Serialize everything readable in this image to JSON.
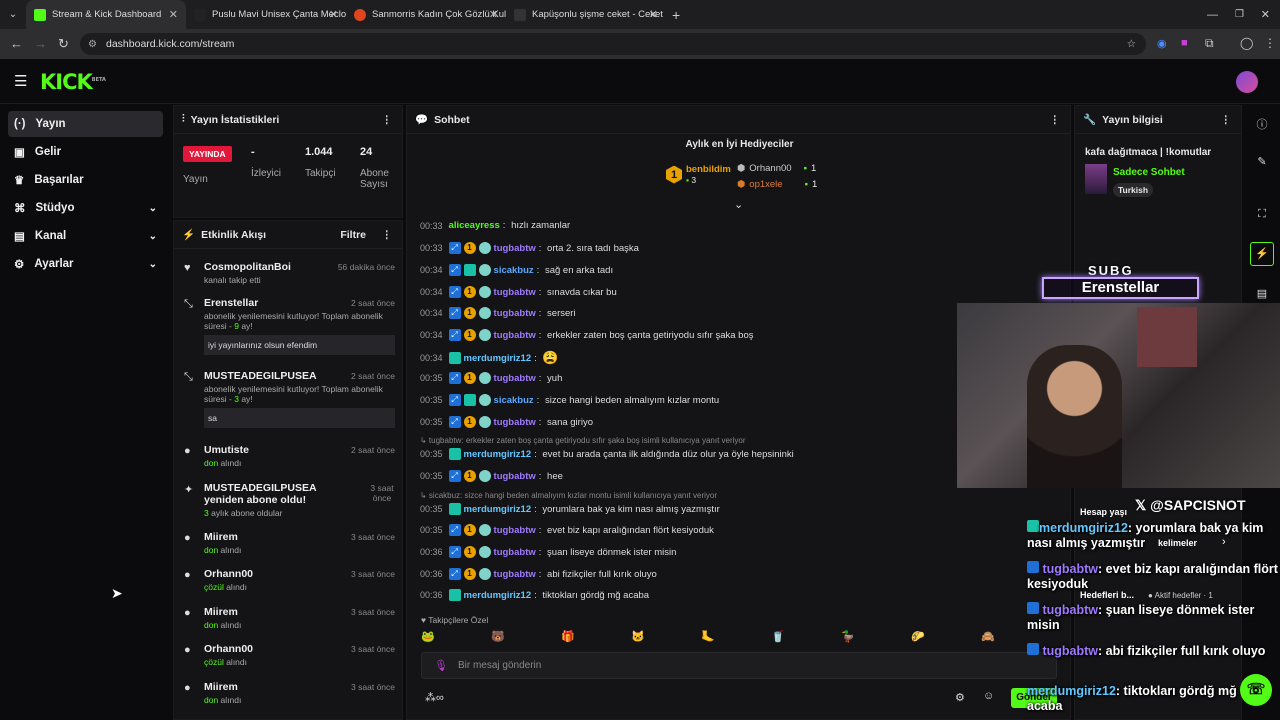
{
  "browser": {
    "tabs": [
      {
        "title": "Stream & Kick Dashboard",
        "active": true
      },
      {
        "title": "Puslu Mavi Unisex Çanta Meclo"
      },
      {
        "title": "Sanmorris Kadın Çok Gözlü Kul"
      },
      {
        "title": "Kapüşonlu şişme ceket - Ceket"
      }
    ],
    "url": "dashboard.kick.com/stream"
  },
  "app": {
    "logo": "KICK",
    "logo_sup": "BETA"
  },
  "sidebar": {
    "items": [
      {
        "label": "Yayın",
        "icon": "broadcast-icon",
        "active": true
      },
      {
        "label": "Gelir",
        "icon": "wallet-icon"
      },
      {
        "label": "Başarılar",
        "icon": "trophy-icon"
      },
      {
        "label": "Stüdyo",
        "icon": "studio-icon",
        "expandable": true
      },
      {
        "label": "Kanal",
        "icon": "channel-icon",
        "expandable": true
      },
      {
        "label": "Ayarlar",
        "icon": "gear-icon",
        "expandable": true
      }
    ]
  },
  "stats": {
    "title": "Yayın İstatistikleri",
    "live_badge": "YAYINDA",
    "live_label": "Yayın",
    "viewers_value": "-",
    "viewers_label": "İzleyici",
    "followers_value": "1.044",
    "followers_label": "Takipçi",
    "subs_value": "24",
    "subs_label": "Abone Sayısı"
  },
  "activity": {
    "title": "Etkinlik Akışı",
    "filter_label": "Filtre",
    "events": [
      {
        "name": "CosmopolitanBoi",
        "time": "56 dakika önce",
        "sub": "kanalı takip etti"
      },
      {
        "name": "Erenstellar",
        "time": "2 saat önce",
        "sub_pre": "abonelik yenilemesini kutluyor! Toplam abonelik süresi - ",
        "sub_hl": "9",
        "sub_post": " ay!",
        "msg": "iyi yayınlarınız olsun efendim"
      },
      {
        "name": "MUSTEADEGILPUSEA",
        "time": "2 saat önce",
        "sub_pre": "abonelik yenilemesini kutluyor! Toplam abonelik süresi - ",
        "sub_hl": "3",
        "sub_post": " ay!",
        "msg": "sa"
      },
      {
        "name": "Umutiste",
        "time": "2 saat önce",
        "sub_hl": "don",
        "sub_post": " alındı"
      },
      {
        "name": "MUSTEADEGILPUSEA yeniden abone oldu!",
        "time": "3 saat önce",
        "sub_hl": "3",
        "sub_post": " aylık abone oldular"
      },
      {
        "name": "Miirem",
        "time": "3 saat önce",
        "sub_hl": "don",
        "sub_post": " alındı"
      },
      {
        "name": "Orhann00",
        "time": "3 saat önce",
        "sub_hl": "çözül",
        "sub_post": " alındı"
      },
      {
        "name": "Miirem",
        "time": "3 saat önce",
        "sub_hl": "don",
        "sub_post": " alındı"
      },
      {
        "name": "Orhann00",
        "time": "3 saat önce",
        "sub_hl": "çözül",
        "sub_post": " alındı"
      },
      {
        "name": "Miirem",
        "time": "3 saat önce",
        "sub_hl": "don",
        "sub_post": " alındı"
      }
    ]
  },
  "chat": {
    "title": "Sohbet",
    "gifters_title": "Aylık en İyi Hediyeciler",
    "gifters": [
      {
        "rank": "1",
        "name": "benbildim",
        "count": "3"
      },
      {
        "name": "Orhann00",
        "count": "1"
      },
      {
        "name": "op1xele",
        "count": "1"
      }
    ],
    "messages": [
      {
        "time": "00:33",
        "user": "aliceayress",
        "cls": "u-ali",
        "text": "hızlı zamanlar",
        "badges": false
      },
      {
        "time": "00:33",
        "user": "tugbabtw",
        "cls": "u-tug",
        "text": "orta 2. sıra tadı başka"
      },
      {
        "time": "00:34",
        "user": "sicakbuz",
        "cls": "u-sic",
        "text": "sağ en arka tadı"
      },
      {
        "time": "00:34",
        "user": "tugbabtw",
        "cls": "u-tug",
        "text": "sınavda cıkar bu"
      },
      {
        "time": "00:34",
        "user": "tugbabtw",
        "cls": "u-tug",
        "text": "serseri"
      },
      {
        "time": "00:34",
        "user": "tugbabtw",
        "cls": "u-tug",
        "text": "erkekler zaten boş çanta getiriyodu sıfır şaka boş"
      },
      {
        "time": "00:34",
        "user": "merdumgiriz12",
        "cls": "u-mer",
        "text": "😩",
        "mer": true
      },
      {
        "time": "00:35",
        "user": "tugbabtw",
        "cls": "u-tug",
        "text": "yuh"
      },
      {
        "time": "00:35",
        "user": "sicakbuz",
        "cls": "u-sic",
        "text": "sizce hangi beden almalıyım kızlar montu"
      },
      {
        "time": "00:35",
        "user": "tugbabtw",
        "cls": "u-tug",
        "text": "sana giriyo"
      },
      {
        "reply": "↳ tugbabtw: erkekler zaten boş çanta getiriyodu sıfır şaka boş isimli kullanıcıya yanıt veriyor"
      },
      {
        "time": "00:35",
        "user": "merdumgiriz12",
        "cls": "u-mer",
        "text": "evet bu arada çanta ilk aldığında düz olur ya öyle hepsininki",
        "mer": true
      },
      {
        "time": "00:35",
        "user": "tugbabtw",
        "cls": "u-tug",
        "text": "hee"
      },
      {
        "reply": "↳ sicakbuz: sizce hangi beden almalıyım kızlar montu isimli kullanıcıya yanıt veriyor"
      },
      {
        "time": "00:35",
        "user": "merdumgiriz12",
        "cls": "u-mer",
        "text": "yorumlara bak ya kim nası almış yazmıştır",
        "mer": true
      },
      {
        "time": "00:35",
        "user": "tugbabtw",
        "cls": "u-tug",
        "text": "evet biz kapı aralığından flört kesiyoduk"
      },
      {
        "time": "00:36",
        "user": "tugbabtw",
        "cls": "u-tug",
        "text": "şuan liseye dönmek ister misin"
      },
      {
        "time": "00:36",
        "user": "tugbabtw",
        "cls": "u-tug",
        "text": "abi fizikçiler full kırık oluyo"
      },
      {
        "time": "00:36",
        "user": "merdumgiriz12",
        "cls": "u-mer",
        "text": "tiktokları gördğ mğ acaba",
        "mer": true
      }
    ],
    "followers_only": "♥ Takipçilere Özel",
    "input_placeholder": "Bir mesaj gönderin",
    "send_label": "Gönder"
  },
  "streaminfo": {
    "title": "Yayın bilgisi",
    "stream_title": "kafa dağıtmaca | !komutlar",
    "category": "Sadece Sohbet",
    "tag": "Turkish"
  },
  "overlay": {
    "brand": "SUBG",
    "name": "Erenstellar",
    "x_handle": "@SAPCISNOT",
    "hesap": "Hesap yaşı",
    "kelimeler": "kelimeler",
    "hedefler": "Hedefleri b...",
    "aktif": "● Aktif hedefler · 1",
    "lines": [
      {
        "user": "merdumgiriz12",
        "text": ": yorumlara bak ya kim nası almış yazmıştır"
      },
      {
        "user": "tugbabtw",
        "text": ": evet biz kapı aralığından flört kesiyoduk"
      },
      {
        "user": "tugbabtw",
        "text": ": şuan liseye dönmek ister misin"
      },
      {
        "user": "tugbabtw",
        "text": ": abi fizikçiler full kırık oluyo"
      },
      {
        "user": "merdumgiriz12",
        "text": ": tiktokları gördğ mğ acaba"
      }
    ]
  }
}
